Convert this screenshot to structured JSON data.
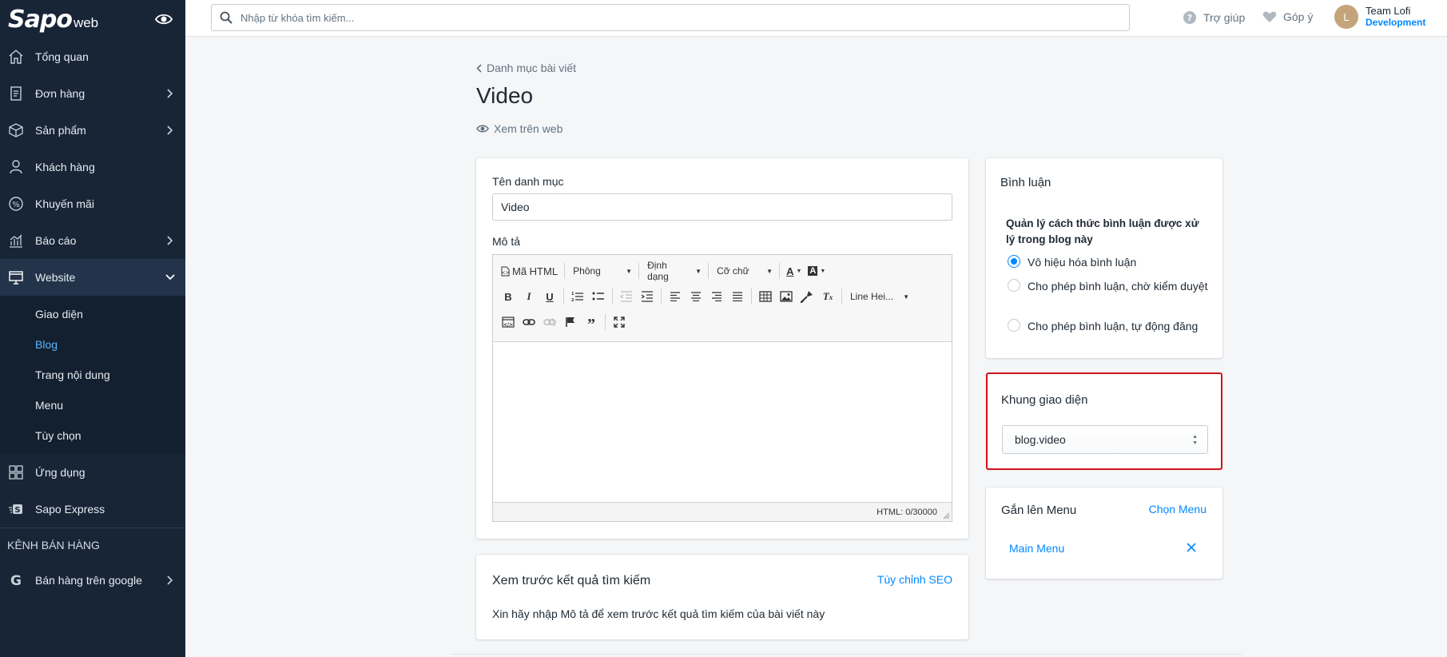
{
  "app": {
    "logo_text": "Sapo",
    "logo_sub": "web"
  },
  "topbar": {
    "search_placeholder": "Nhập từ khóa tìm kiếm...",
    "help_label": "Trợ giúp",
    "feedback_label": "Góp ý",
    "user": {
      "initial": "L",
      "name": "Team Lofi",
      "role": "Development"
    }
  },
  "sidebar": {
    "items": [
      {
        "label": "Tổng quan",
        "icon": "home-icon"
      },
      {
        "label": "Đơn hàng",
        "icon": "order-icon"
      },
      {
        "label": "Sản phẩm",
        "icon": "product-icon"
      },
      {
        "label": "Khách hàng",
        "icon": "customer-icon"
      },
      {
        "label": "Khuyến mãi",
        "icon": "discount-icon"
      },
      {
        "label": "Báo cáo",
        "icon": "report-icon"
      },
      {
        "label": "Website",
        "icon": "website-icon"
      }
    ],
    "website_sub": [
      {
        "label": "Giao diện"
      },
      {
        "label": "Blog"
      },
      {
        "label": "Trang nội dung"
      },
      {
        "label": "Menu"
      },
      {
        "label": "Tùy chọn"
      }
    ],
    "apps_label": "Ứng dụng",
    "express_label": "Sapo Express",
    "channels_title": "KÊNH BÁN HÀNG",
    "google_label": "Bán hàng trên google"
  },
  "page": {
    "breadcrumb": "Danh mục bài viết",
    "title": "Video",
    "view_on_web": "Xem trên web"
  },
  "form": {
    "name_label": "Tên danh mục",
    "name_value": "Video",
    "desc_label": "Mô tả",
    "editor": {
      "html_btn": "Mã HTML",
      "font_dd": "Phông",
      "format_dd": "Định dạng",
      "size_dd": "Cỡ chữ",
      "line_height_dd": "Line Hei...",
      "counter": "HTML: 0/30000"
    }
  },
  "seo": {
    "title": "Xem trước kết quả tìm kiếm",
    "customize_link": "Tùy chỉnh SEO",
    "description": "Xin hãy nhập Mô tả để xem trước kết quả tìm kiếm của bài viết này"
  },
  "comments": {
    "title": "Bình luận",
    "question": "Quản lý cách thức bình luận được xử lý trong blog này",
    "options": [
      {
        "label": "Vô hiệu hóa bình luận",
        "checked": true
      },
      {
        "label": "Cho phép bình luận, chờ kiểm duyệt",
        "checked": false
      },
      {
        "label": "Cho phép bình luận, tự động đăng",
        "checked": false
      }
    ]
  },
  "template": {
    "title": "Khung giao diện",
    "selected": "blog.video",
    "highlight_color": "#d0141b"
  },
  "menu_attach": {
    "title": "Gắn lên Menu",
    "choose_link": "Chọn Menu",
    "item": "Main Menu"
  },
  "colors": {
    "sidebar_bg": "#182537",
    "accent": "#0088ff",
    "page_bg": "#f4f6f8"
  }
}
